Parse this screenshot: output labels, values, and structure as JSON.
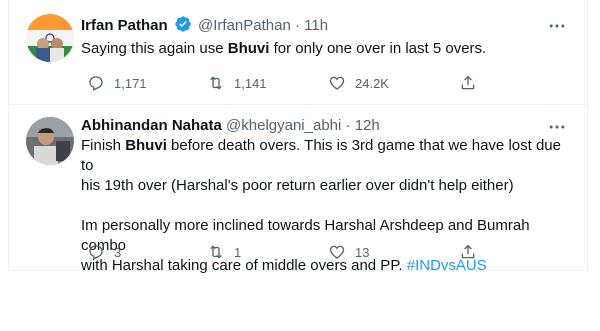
{
  "tweets": [
    {
      "name": "Irfan Pathan",
      "verified": true,
      "handle": "@IrfanPathan",
      "separator": "·",
      "time": "11h",
      "text_parts": [
        "Saying this again use ",
        "Bhuvi",
        " for only one over in last 5 overs."
      ],
      "reply_count": "1,171",
      "retweet_count": "1,141",
      "like_count": "24.2K"
    },
    {
      "name": "Abhinandan Nahata",
      "verified": false,
      "handle": "@khelgyani_abhi",
      "separator": "·",
      "time": "12h",
      "line1_parts": [
        "Finish ",
        "Bhuvi",
        " before death overs. This is 3rd game that we have lost due to"
      ],
      "line2": "his 19th over (Harshal's poor return earlier over didn't help either)",
      "line3": "Im personally more inclined towards Harshal Arshdeep and Bumrah combo",
      "line4_text": "with Harshal taking care of middle overs and PP. ",
      "hashtag": "#INDvsAUS",
      "reply_count": "3",
      "retweet_count": "1",
      "like_count": "13"
    }
  ],
  "colors": {
    "text": "#0f1419",
    "secondary": "#536471",
    "link": "#1d9bf0",
    "verified": "#1d9bf0",
    "border": "#eff3f4"
  },
  "icons": [
    "verified-badge-icon",
    "more-icon",
    "reply-icon",
    "retweet-icon",
    "like-icon",
    "share-icon"
  ]
}
